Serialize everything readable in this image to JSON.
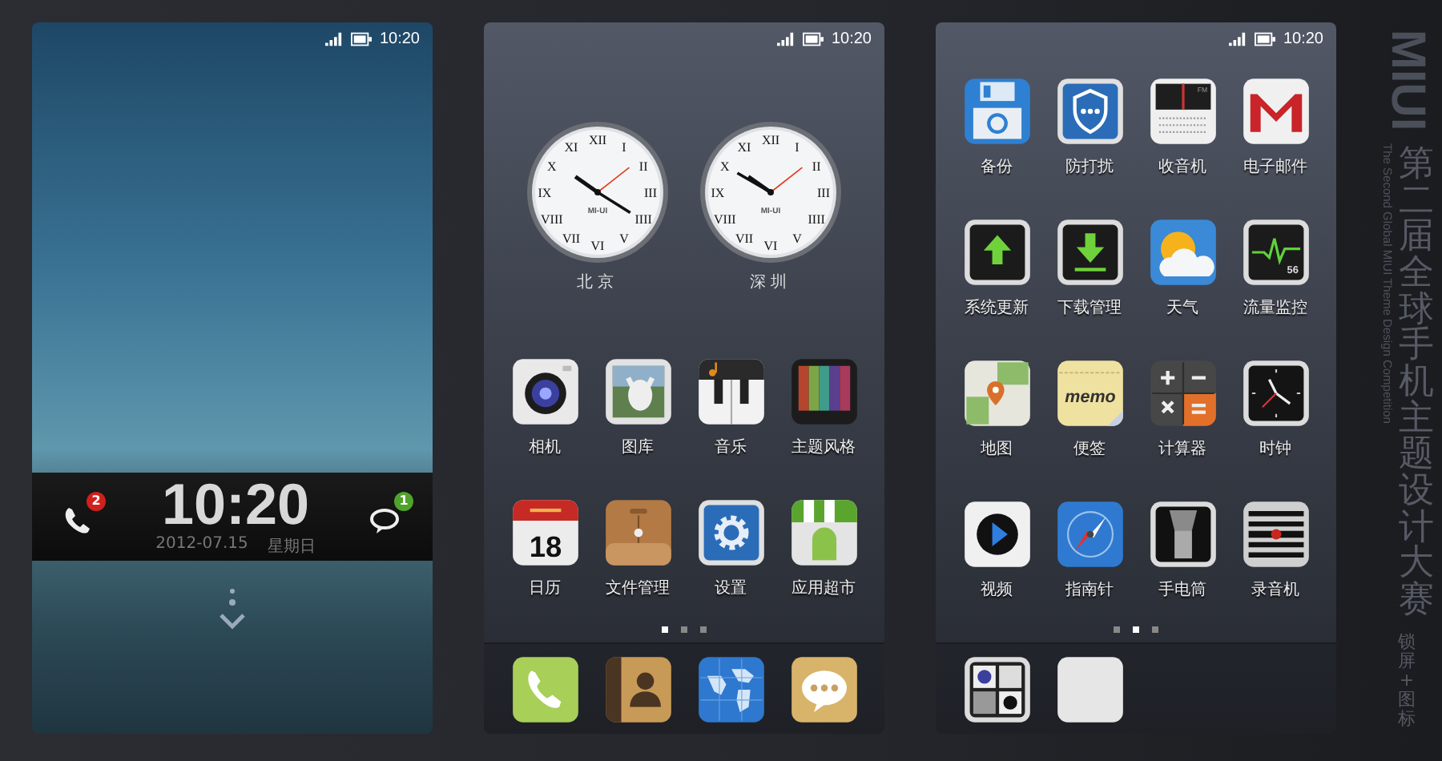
{
  "screens": [
    {
      "kind": "lock",
      "status_time": "10:20",
      "lock_bar": {
        "missed_calls": "2",
        "time": "10:20",
        "date": "2012-07.15",
        "weekday": "星期日",
        "messages": "1"
      }
    },
    {
      "kind": "home",
      "status_time": "10:20",
      "clocks": [
        {
          "brand": "MI-UI",
          "city": "北京",
          "numerals": [
            "XI",
            "XII",
            "I",
            "X",
            "II",
            "IX",
            "III",
            "VIII",
            "IIII",
            "VII",
            "VI",
            "V"
          ]
        },
        {
          "brand": "MI-UI",
          "city": "深圳",
          "numerals": [
            "XI",
            "XII",
            "I",
            "X",
            "II",
            "IX",
            "III",
            "VIII",
            "IIII",
            "VII",
            "VI",
            "V"
          ]
        }
      ],
      "apps": [
        {
          "kind": "camera",
          "label": "相机"
        },
        {
          "kind": "gallery",
          "label": "图库"
        },
        {
          "kind": "music",
          "label": "音乐"
        },
        {
          "kind": "theme",
          "label": "主题风格"
        },
        {
          "kind": "calendar",
          "label": "日历",
          "icon_text": "18"
        },
        {
          "kind": "files",
          "label": "文件管理"
        },
        {
          "kind": "settings",
          "label": "设置"
        },
        {
          "kind": "market",
          "label": "应用超市"
        }
      ],
      "page_dots": [
        {
          "selected": true
        },
        {
          "selected": false
        },
        {
          "selected": false
        }
      ],
      "dock": [
        {
          "kind": "phone"
        },
        {
          "kind": "contacts"
        },
        {
          "kind": "browser"
        },
        {
          "kind": "messages"
        }
      ]
    },
    {
      "kind": "home",
      "status_time": "10:20",
      "apps": [
        {
          "kind": "backup",
          "label": "备份"
        },
        {
          "kind": "shield",
          "label": "防打扰"
        },
        {
          "kind": "radio",
          "label": "收音机",
          "icon_text": "FM"
        },
        {
          "kind": "mail",
          "label": "电子邮件"
        },
        {
          "kind": "update",
          "label": "系统更新"
        },
        {
          "kind": "download",
          "label": "下载管理"
        },
        {
          "kind": "weather",
          "label": "天气"
        },
        {
          "kind": "monitor",
          "label": "流量监控",
          "icon_text": "56"
        },
        {
          "kind": "map",
          "label": "地图"
        },
        {
          "kind": "notes",
          "label": "便签",
          "icon_text": "memo"
        },
        {
          "kind": "calculator",
          "label": "计算器"
        },
        {
          "kind": "clock",
          "label": "时钟"
        },
        {
          "kind": "video",
          "label": "视频"
        },
        {
          "kind": "compass",
          "label": "指南针"
        },
        {
          "kind": "flashlight",
          "label": "手电筒"
        },
        {
          "kind": "recorder",
          "label": "录音机"
        }
      ],
      "page_dots": [
        {
          "selected": false
        },
        {
          "selected": true
        },
        {
          "selected": false
        }
      ],
      "dock": [
        {
          "kind": "folder"
        },
        {
          "kind": "empty"
        }
      ]
    }
  ],
  "banner": {
    "logo": "MIUI",
    "title": "第二届全球手机主题设计大赛",
    "subtitle": "The Second Global MIUI Theme Design Competition",
    "caption": "锁屏 + 图标"
  }
}
